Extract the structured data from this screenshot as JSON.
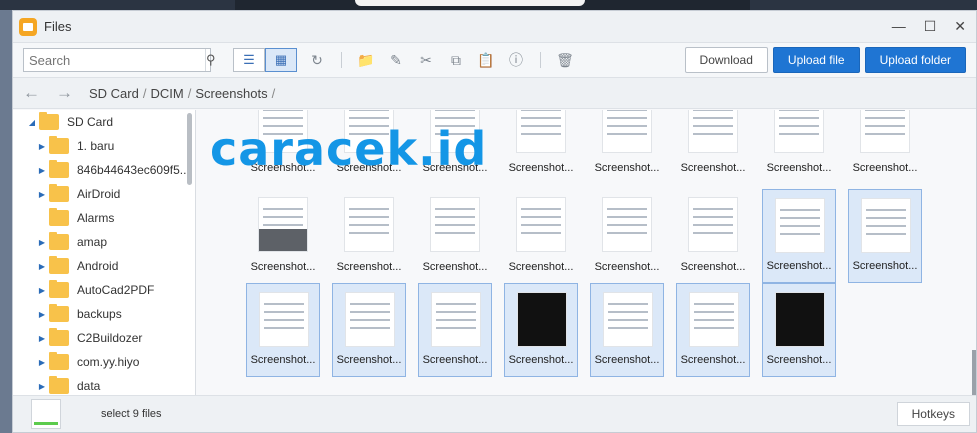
{
  "window": {
    "title": "Files",
    "icon": "files-app-icon"
  },
  "toolbar": {
    "search_placeholder": "Search",
    "download_label": "Download",
    "upload_file_label": "Upload file",
    "upload_folder_label": "Upload folder"
  },
  "breadcrumb": {
    "items": [
      "SD Card",
      "DCIM",
      "Screenshots"
    ]
  },
  "tree": {
    "root": "SD Card",
    "items": [
      "1. baru",
      "846b44643ec609f5...",
      "AirDroid",
      "Alarms",
      "amap",
      "Android",
      "AutoCad2PDF",
      "backups",
      "C2Buildozer",
      "com.yy.hiyo",
      "data"
    ]
  },
  "files": [
    "Screenshot...",
    "Screenshot...",
    "Screenshot...",
    "Screenshot...",
    "Screenshot...",
    "Screenshot...",
    "Screenshot...",
    "Screenshot...",
    "Screenshot...",
    "Screenshot...",
    "Screenshot...",
    "Screenshot...",
    "Screenshot...",
    "Screenshot...",
    "Screenshot...",
    "Screenshot...",
    "Screenshot...",
    "Screenshot...",
    "Screenshot...",
    "Screenshot...",
    "Screenshot...",
    "Screenshot...",
    "Screenshot..."
  ],
  "watermark": "caracek.id",
  "status": {
    "selection_text": "select 9 files",
    "hotkeys_label": "Hotkeys"
  },
  "colors": {
    "accent": "#1f75d3",
    "selection": "#dbe8f8",
    "folder": "#f8c24a",
    "watermark": "#1496e6"
  }
}
